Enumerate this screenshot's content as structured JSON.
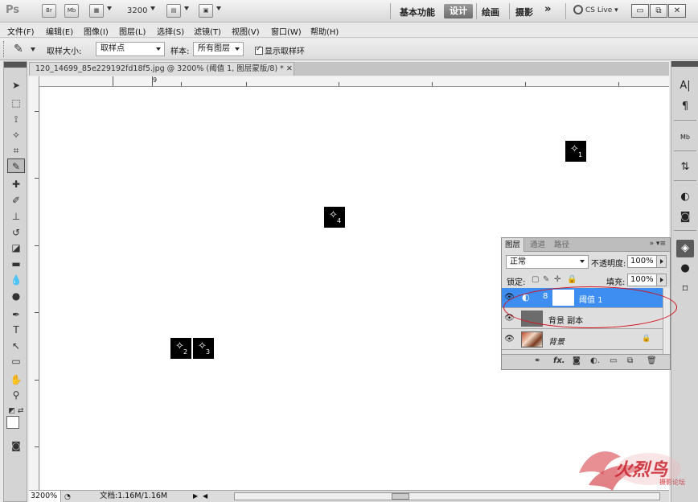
{
  "appbar": {
    "logo": "Ps",
    "bridge_btn": "Br",
    "minibridge_btn": "Mb",
    "zoom": "3200",
    "workspaces": [
      "基本功能",
      "设计",
      "绘画",
      "摄影"
    ],
    "active_workspace": "设计",
    "more": "»",
    "cslive": "CS Live"
  },
  "menu": [
    "文件(F)",
    "编辑(E)",
    "图像(I)",
    "图层(L)",
    "选择(S)",
    "滤镜(T)",
    "视图(V)",
    "窗口(W)",
    "帮助(H)"
  ],
  "options": {
    "sample_size_label": "取样大小:",
    "sample_size_value": "取样点",
    "sample_label": "样本:",
    "sample_value": "所有图层",
    "show_ring_label": "显示取样环",
    "show_ring_checked": true
  },
  "document": {
    "tab_title": "120_14699_85e229192fd18f5.jpg @ 3200% (阈值 1, 图层蒙版/8) * ✕",
    "ruler_label": "9",
    "samplers": [
      {
        "label": "1"
      },
      {
        "label": "4"
      },
      {
        "label": "2"
      },
      {
        "label": "3"
      }
    ]
  },
  "status": {
    "zoom": "3200%",
    "doc_info": "文档:1.16M/1.16M"
  },
  "layers_panel": {
    "tabs": [
      "图层",
      "通道",
      "路径"
    ],
    "active_tab": "图层",
    "blend_mode": "正常",
    "opacity_label": "不透明度:",
    "opacity_value": "100%",
    "lock_label": "锁定:",
    "fill_label": "填充:",
    "fill_value": "100%",
    "layers": [
      {
        "name": "阈值 1",
        "selected": true,
        "type": "adjustment"
      },
      {
        "name": "背景 副本",
        "selected": false,
        "type": "layer"
      },
      {
        "name": "背景",
        "selected": false,
        "type": "background"
      }
    ]
  },
  "colors": {
    "selection": "#3d8ef0",
    "annotation": "#d3121b",
    "workspace_active": "#7a7a7a"
  },
  "watermark": {
    "text": "火烈鸟",
    "subtext": "摄影论坛"
  }
}
